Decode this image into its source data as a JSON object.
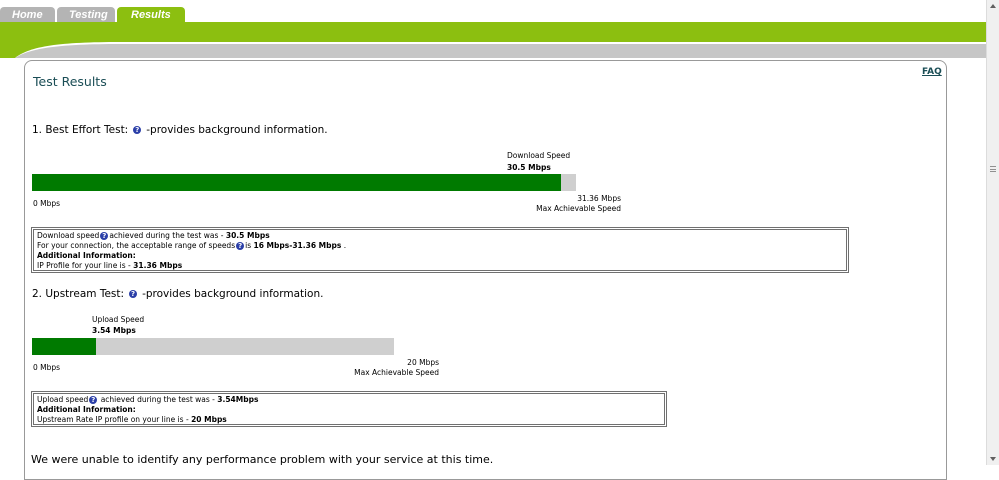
{
  "tabs": [
    {
      "label": "Home",
      "active": false
    },
    {
      "label": "Testing",
      "active": false
    },
    {
      "label": "Results",
      "active": true
    }
  ],
  "colors": {
    "accent": "#8cbf10",
    "tab_inactive": "#b4b4b4",
    "bar_fill": "#007a00",
    "bar_track": "#cfcfcf",
    "title": "#1a4d55"
  },
  "page": {
    "title": "Test Results",
    "faq_label": "FAQ"
  },
  "best_effort": {
    "heading": "1. Best Effort Test:",
    "heading_suffix": "-provides background information.",
    "speed_label": "Download Speed",
    "speed_value": "30.5 Mbps",
    "min_label": "0 Mbps",
    "max_value": "31.36 Mbps",
    "max_label": "Max Achievable Speed",
    "fill_fraction": 0.9726,
    "info": {
      "line1_prefix": "Download speed",
      "line1_middle": "achieved during the test was - ",
      "line1_value": "30.5 Mbps",
      "line2_prefix": "For your connection, the acceptable range of speeds",
      "line2_middle": "is ",
      "line2_value": "16 Mbps-31.36 Mbps",
      "line2_suffix": " .",
      "additional": "Additional Information:",
      "line4_prefix": "IP Profile for your line is - ",
      "line4_value": "31.36 Mbps"
    }
  },
  "upstream": {
    "heading": "2. Upstream Test:",
    "heading_suffix": "-provides background information.",
    "speed_label": "Upload Speed",
    "speed_value": "3.54 Mbps",
    "min_label": "0 Mbps",
    "max_value": "20 Mbps",
    "max_label": "Max Achievable Speed",
    "fill_fraction": 0.177,
    "info": {
      "line1_prefix": "Upload speed",
      "line1_middle": " achieved during the test was - ",
      "line1_value": "3.54Mbps",
      "additional": "Additional Information:",
      "line3_prefix": "Upstream Rate IP profile on your line is - ",
      "line3_value": "20 Mbps"
    }
  },
  "footer_message": "We were unable to identify any performance problem with your service at this time."
}
